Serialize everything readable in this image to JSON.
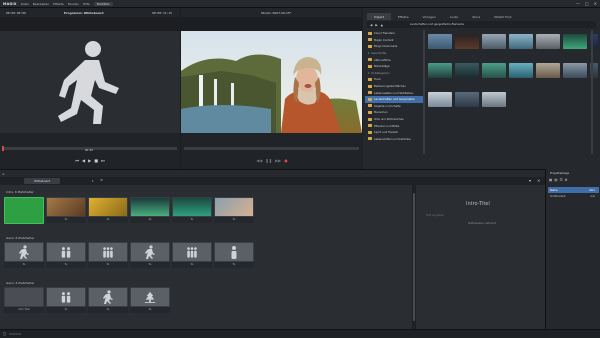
{
  "app": {
    "logo": "MAGIX",
    "menu": [
      "Datei",
      "Bearbeiten",
      "Effekte",
      "Fenster",
      "Hilfe"
    ],
    "active_button": "Funktion",
    "window_controls": [
      "—",
      "□",
      "✕"
    ]
  },
  "left_monitor": {
    "timecode_left": "00:00:00:00",
    "title": "Programm: Whiteboard",
    "timecode_right": "00:00:11:15",
    "bottom_timecode": "00:00"
  },
  "right_monitor": {
    "title": "Studio: 0007:00:15*",
    "timecode_left": "",
    "timecode_right": ""
  },
  "media_pool": {
    "tabs": [
      "Import",
      "Effekte",
      "Vorlagen",
      "Audio",
      "Store",
      "MAGIX Font"
    ],
    "active_tab": "Import",
    "path": "Landschaften und geografische Elemente",
    "folders": [
      {
        "label": "Cloud Transfers",
        "type": "folder"
      },
      {
        "label": "Magix Content",
        "type": "folder"
      },
      {
        "label": "Bingo Downloads",
        "type": "folder"
      },
      {
        "label": "Geschichte",
        "type": "group"
      },
      {
        "label": "Aktionsfilme",
        "type": "folder"
      },
      {
        "label": "Naturalläge",
        "type": "folder"
      },
      {
        "label": "KI-Kategorien",
        "type": "group"
      },
      {
        "label": "Tiere",
        "type": "folder"
      },
      {
        "label": "Bedienungsoberflächen",
        "type": "folder"
      },
      {
        "label": "Lebenswelten und Städtebau",
        "type": "folder"
      },
      {
        "label": "Landschaften und Geographie",
        "type": "selected"
      },
      {
        "label": "Objekte und Inhalte",
        "type": "folder"
      },
      {
        "label": "Menschen",
        "type": "folder"
      },
      {
        "label": "Orte und Wahrzeichen",
        "type": "folder"
      },
      {
        "label": "Pflanzen und Blüte",
        "type": "folder"
      },
      {
        "label": "Sport und Freizeit",
        "type": "folder"
      },
      {
        "label": "Lebensmittel und Getränke",
        "type": "folder"
      }
    ]
  },
  "storyboard": {
    "tab": "Whiteboard",
    "tab_count": "1",
    "groups": [
      {
        "title": "Intro, 6 Platzhalter"
      },
      {
        "title": "Ganz, 6 Platzhalter"
      },
      {
        "title": "Ganz, 4 Platzhalter"
      }
    ],
    "scene_label": "5s",
    "scene_label_first": "Intro-Titel",
    "preview_title": "Intro-Titel",
    "preview_sub": "Text eingeben",
    "preview_caption": "Textbaustein aktiviert"
  },
  "properties": {
    "title": "Projektablage",
    "rows": [
      {
        "k": "Name",
        "v": "Intro"
      },
      {
        "k": "Sichtbarkeit",
        "v": "Aus"
      }
    ]
  },
  "status": {
    "left": "□"
  },
  "colors": {
    "accent": "#3f6ea8",
    "green_scene": "#2ea043",
    "record": "#d94848"
  }
}
